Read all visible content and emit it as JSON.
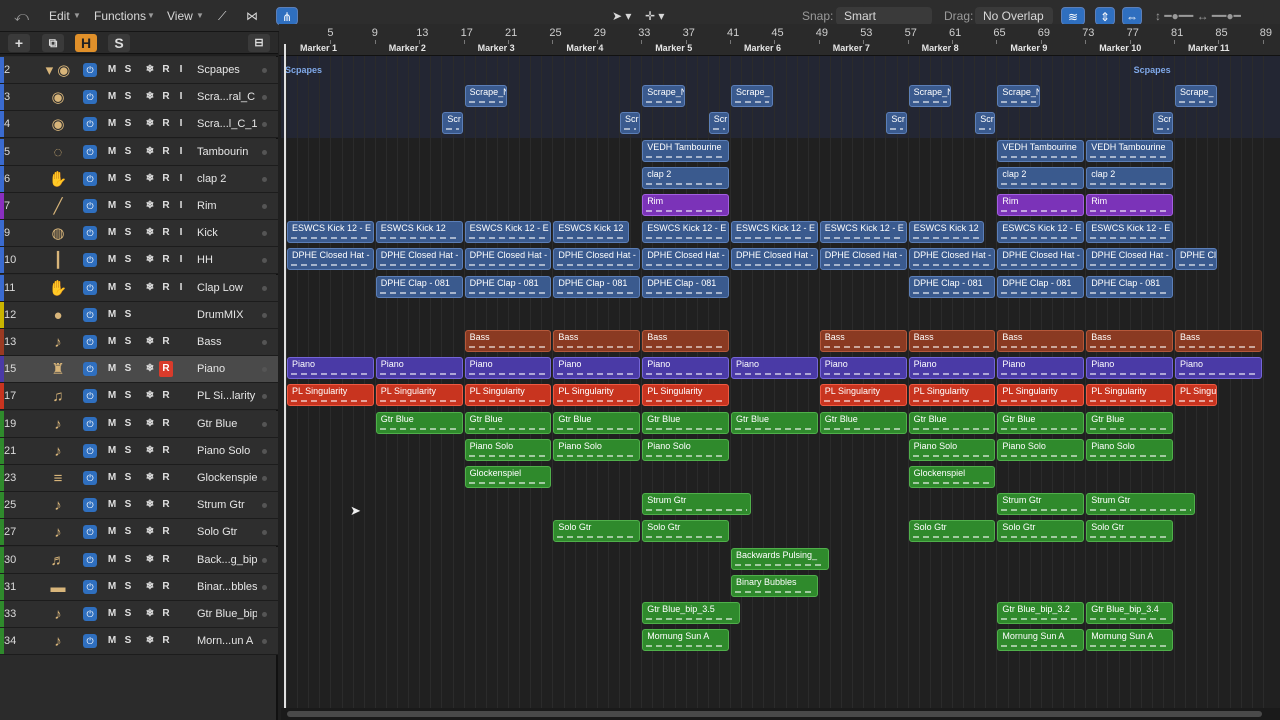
{
  "toolbar": {
    "back_icon": "back-arrow-icon",
    "menus": [
      "Edit",
      "Functions",
      "View"
    ],
    "snap_label": "Snap:",
    "snap_value": "Smart",
    "drag_label": "Drag:",
    "drag_value": "No Overlap"
  },
  "header_buttons": [
    "+",
    "H",
    "S"
  ],
  "ruler": {
    "bars": [
      "5",
      "9",
      "13",
      "17",
      "21",
      "25",
      "29",
      "33",
      "37",
      "41",
      "45",
      "49",
      "53",
      "57",
      "61",
      "65",
      "69",
      "73",
      "77",
      "81",
      "85",
      "89"
    ],
    "markers": [
      "Marker 1",
      "Marker 2",
      "Marker 3",
      "Marker 4",
      "Marker 5",
      "Marker 6",
      "Marker 7",
      "Marker 8",
      "Marker 9",
      "Marker 10",
      "Marker 11"
    ]
  },
  "tracks": [
    {
      "num": "2",
      "name": "Scpapes",
      "color": "#3a6bd0",
      "icon": "▾ ◉",
      "selected": false,
      "r": false
    },
    {
      "num": "3",
      "name": "Scra...ral_C",
      "color": "#3a6bd0",
      "icon": "◉",
      "selected": false,
      "r": false
    },
    {
      "num": "4",
      "name": "Scra...l_C_1",
      "color": "#3a6bd0",
      "icon": "◉",
      "selected": false,
      "r": false
    },
    {
      "num": "5",
      "name": "Tambourin",
      "color": "#3a6bd0",
      "icon": "◌",
      "selected": false,
      "r": false
    },
    {
      "num": "6",
      "name": "clap 2",
      "color": "#3a6bd0",
      "icon": "✋",
      "selected": false,
      "r": false
    },
    {
      "num": "7",
      "name": "Rim",
      "color": "#8a2fc0",
      "icon": "╱",
      "selected": false,
      "r": false
    },
    {
      "num": "9",
      "name": "Kick",
      "color": "#3a6bd0",
      "icon": "◍",
      "selected": false,
      "r": false
    },
    {
      "num": "10",
      "name": "HH",
      "color": "#3a6bd0",
      "icon": "┃",
      "selected": false,
      "r": false
    },
    {
      "num": "11",
      "name": "Clap Low",
      "color": "#3a6bd0",
      "icon": "✋",
      "selected": false,
      "r": false
    },
    {
      "num": "12",
      "name": "DrumMIX",
      "color": "#c9b400",
      "icon": "●",
      "selected": false,
      "r": false
    },
    {
      "num": "13",
      "name": "Bass",
      "color": "#9a3a22",
      "icon": "♪",
      "selected": false,
      "r": false
    },
    {
      "num": "15",
      "name": "Piano",
      "color": "#4a3aa6",
      "icon": "♜",
      "selected": true,
      "r": true
    },
    {
      "num": "17",
      "name": "PL Si...larity",
      "color": "#c8341f",
      "icon": "♫",
      "selected": false,
      "r": false
    },
    {
      "num": "19",
      "name": "Gtr Blue",
      "color": "#2f8a2c",
      "icon": "♪",
      "selected": false,
      "r": false
    },
    {
      "num": "21",
      "name": "Piano Solo",
      "color": "#2f8a2c",
      "icon": "♪",
      "selected": false,
      "r": false
    },
    {
      "num": "23",
      "name": "Glockenspiel",
      "color": "#2f8a2c",
      "icon": "≡",
      "selected": false,
      "r": false
    },
    {
      "num": "25",
      "name": "Strum Gtr",
      "color": "#2f8a2c",
      "icon": "♪",
      "selected": false,
      "r": false
    },
    {
      "num": "27",
      "name": "Solo Gtr",
      "color": "#2f8a2c",
      "icon": "♪",
      "selected": false,
      "r": false
    },
    {
      "num": "30",
      "name": "Back...g_bip",
      "color": "#2f8a2c",
      "icon": "♬",
      "selected": false,
      "r": false
    },
    {
      "num": "31",
      "name": "Binar...bbles",
      "color": "#2f8a2c",
      "icon": "▬",
      "selected": false,
      "r": false
    },
    {
      "num": "33",
      "name": "Gtr Blue_bip",
      "color": "#2f8a2c",
      "icon": "♪",
      "selected": false,
      "r": false
    },
    {
      "num": "34",
      "name": "Morn...un A",
      "color": "#2f8a2c",
      "icon": "♪",
      "selected": false,
      "r": false
    }
  ],
  "lane_labels": [
    "Scpapes",
    "Scpapes"
  ],
  "regions": [
    {
      "lane": 1,
      "bar": 17,
      "len": 4,
      "label": "Scrape_N",
      "color": "blue"
    },
    {
      "lane": 1,
      "bar": 33,
      "len": 4,
      "label": "Scrape_N",
      "color": "blue"
    },
    {
      "lane": 1,
      "bar": 41,
      "len": 4,
      "label": "Scrape_",
      "color": "blue"
    },
    {
      "lane": 1,
      "bar": 57,
      "len": 4,
      "label": "Scrape_N",
      "color": "blue"
    },
    {
      "lane": 1,
      "bar": 65,
      "len": 4,
      "label": "Scrape_N",
      "color": "blue"
    },
    {
      "lane": 1,
      "bar": 81,
      "len": 4,
      "label": "Scrape_",
      "color": "blue"
    },
    {
      "lane": 2,
      "bar": 15,
      "len": 2,
      "label": "Scr",
      "color": "blue"
    },
    {
      "lane": 2,
      "bar": 31,
      "len": 2,
      "label": "Scr",
      "color": "blue"
    },
    {
      "lane": 2,
      "bar": 39,
      "len": 2,
      "label": "Scr",
      "color": "blue"
    },
    {
      "lane": 2,
      "bar": 55,
      "len": 2,
      "label": "Scr",
      "color": "blue"
    },
    {
      "lane": 2,
      "bar": 63,
      "len": 2,
      "label": "Scr",
      "color": "blue"
    },
    {
      "lane": 2,
      "bar": 79,
      "len": 2,
      "label": "Scr",
      "color": "blue"
    },
    {
      "lane": 3,
      "bar": 33,
      "len": 8,
      "label": "VEDH Tambourine",
      "color": "blue"
    },
    {
      "lane": 3,
      "bar": 65,
      "len": 8,
      "label": "VEDH Tambourine",
      "color": "blue"
    },
    {
      "lane": 3,
      "bar": 73,
      "len": 8,
      "label": "VEDH Tambourine",
      "color": "blue"
    },
    {
      "lane": 4,
      "bar": 33,
      "len": 8,
      "label": "clap 2",
      "color": "blue"
    },
    {
      "lane": 4,
      "bar": 65,
      "len": 8,
      "label": "clap 2",
      "color": "blue"
    },
    {
      "lane": 4,
      "bar": 73,
      "len": 8,
      "label": "clap 2",
      "color": "blue"
    },
    {
      "lane": 5,
      "bar": 33,
      "len": 8,
      "label": "Rim",
      "color": "purple"
    },
    {
      "lane": 5,
      "bar": 65,
      "len": 8,
      "label": "Rim",
      "color": "purple"
    },
    {
      "lane": 5,
      "bar": 73,
      "len": 8,
      "label": "Rim",
      "color": "purple"
    },
    {
      "lane": 6,
      "bar": 1,
      "len": 8,
      "label": "ESWCS Kick 12 - E",
      "color": "blue"
    },
    {
      "lane": 6,
      "bar": 9,
      "len": 8,
      "label": "ESWCS Kick 12",
      "color": "blue"
    },
    {
      "lane": 6,
      "bar": 17,
      "len": 8,
      "label": "ESWCS Kick 12 - E",
      "color": "blue"
    },
    {
      "lane": 6,
      "bar": 25,
      "len": 7,
      "label": "ESWCS Kick 12",
      "color": "blue"
    },
    {
      "lane": 6,
      "bar": 33,
      "len": 8,
      "label": "ESWCS Kick 12 - E",
      "color": "blue"
    },
    {
      "lane": 6,
      "bar": 41,
      "len": 8,
      "label": "ESWCS Kick 12 - E",
      "color": "blue"
    },
    {
      "lane": 6,
      "bar": 49,
      "len": 8,
      "label": "ESWCS Kick 12 - E",
      "color": "blue"
    },
    {
      "lane": 6,
      "bar": 57,
      "len": 7,
      "label": "ESWCS Kick 12",
      "color": "blue"
    },
    {
      "lane": 6,
      "bar": 65,
      "len": 8,
      "label": "ESWCS Kick 12 - E",
      "color": "blue"
    },
    {
      "lane": 6,
      "bar": 73,
      "len": 8,
      "label": "ESWCS Kick 12 - E",
      "color": "blue"
    },
    {
      "lane": 7,
      "bar": 1,
      "len": 8,
      "label": "DPHE Closed Hat -",
      "color": "blue"
    },
    {
      "lane": 7,
      "bar": 9,
      "len": 8,
      "label": "DPHE Closed Hat -",
      "color": "blue"
    },
    {
      "lane": 7,
      "bar": 17,
      "len": 8,
      "label": "DPHE Closed Hat -",
      "color": "blue"
    },
    {
      "lane": 7,
      "bar": 25,
      "len": 8,
      "label": "DPHE Closed Hat -",
      "color": "blue"
    },
    {
      "lane": 7,
      "bar": 33,
      "len": 8,
      "label": "DPHE Closed Hat -",
      "color": "blue"
    },
    {
      "lane": 7,
      "bar": 41,
      "len": 8,
      "label": "DPHE Closed Hat -",
      "color": "blue"
    },
    {
      "lane": 7,
      "bar": 49,
      "len": 8,
      "label": "DPHE Closed Hat -",
      "color": "blue"
    },
    {
      "lane": 7,
      "bar": 57,
      "len": 8,
      "label": "DPHE Closed Hat -",
      "color": "blue"
    },
    {
      "lane": 7,
      "bar": 65,
      "len": 8,
      "label": "DPHE Closed Hat -",
      "color": "blue"
    },
    {
      "lane": 7,
      "bar": 73,
      "len": 8,
      "label": "DPHE Closed Hat -",
      "color": "blue"
    },
    {
      "lane": 7,
      "bar": 81,
      "len": 4,
      "label": "DPHE Cl",
      "color": "blue"
    },
    {
      "lane": 8,
      "bar": 9,
      "len": 8,
      "label": "DPHE Clap - 081",
      "color": "blue"
    },
    {
      "lane": 8,
      "bar": 17,
      "len": 8,
      "label": "DPHE Clap - 081",
      "color": "blue"
    },
    {
      "lane": 8,
      "bar": 25,
      "len": 8,
      "label": "DPHE Clap - 081",
      "color": "blue"
    },
    {
      "lane": 8,
      "bar": 33,
      "len": 8,
      "label": "DPHE Clap - 081",
      "color": "blue"
    },
    {
      "lane": 8,
      "bar": 57,
      "len": 8,
      "label": "DPHE Clap - 081",
      "color": "blue"
    },
    {
      "lane": 8,
      "bar": 65,
      "len": 8,
      "label": "DPHE Clap - 081",
      "color": "blue"
    },
    {
      "lane": 8,
      "bar": 73,
      "len": 8,
      "label": "DPHE Clap - 081",
      "color": "blue"
    },
    {
      "lane": 10,
      "bar": 17,
      "len": 8,
      "label": "Bass",
      "color": "brown"
    },
    {
      "lane": 10,
      "bar": 25,
      "len": 8,
      "label": "Bass",
      "color": "brown"
    },
    {
      "lane": 10,
      "bar": 33,
      "len": 8,
      "label": "Bass",
      "color": "brown"
    },
    {
      "lane": 10,
      "bar": 49,
      "len": 8,
      "label": "Bass",
      "color": "brown"
    },
    {
      "lane": 10,
      "bar": 57,
      "len": 8,
      "label": "Bass",
      "color": "brown"
    },
    {
      "lane": 10,
      "bar": 65,
      "len": 8,
      "label": "Bass",
      "color": "brown"
    },
    {
      "lane": 10,
      "bar": 73,
      "len": 8,
      "label": "Bass",
      "color": "brown"
    },
    {
      "lane": 10,
      "bar": 81,
      "len": 8,
      "label": "Bass",
      "color": "brown"
    },
    {
      "lane": 11,
      "bar": 1,
      "len": 8,
      "label": "Piano",
      "color": "indigo"
    },
    {
      "lane": 11,
      "bar": 9,
      "len": 8,
      "label": "Piano",
      "color": "indigo"
    },
    {
      "lane": 11,
      "bar": 17,
      "len": 8,
      "label": "Piano",
      "color": "indigo"
    },
    {
      "lane": 11,
      "bar": 25,
      "len": 8,
      "label": "Piano",
      "color": "indigo"
    },
    {
      "lane": 11,
      "bar": 33,
      "len": 8,
      "label": "Piano",
      "color": "indigo"
    },
    {
      "lane": 11,
      "bar": 41,
      "len": 8,
      "label": "Piano",
      "color": "indigo"
    },
    {
      "lane": 11,
      "bar": 49,
      "len": 8,
      "label": "Piano",
      "color": "indigo"
    },
    {
      "lane": 11,
      "bar": 57,
      "len": 8,
      "label": "Piano",
      "color": "indigo"
    },
    {
      "lane": 11,
      "bar": 65,
      "len": 8,
      "label": "Piano",
      "color": "indigo"
    },
    {
      "lane": 11,
      "bar": 73,
      "len": 8,
      "label": "Piano",
      "color": "indigo"
    },
    {
      "lane": 11,
      "bar": 81,
      "len": 8,
      "label": "Piano",
      "color": "indigo"
    },
    {
      "lane": 12,
      "bar": 1,
      "len": 8,
      "label": "PL Singularity",
      "color": "red"
    },
    {
      "lane": 12,
      "bar": 9,
      "len": 8,
      "label": "PL Singularity",
      "color": "red"
    },
    {
      "lane": 12,
      "bar": 17,
      "len": 8,
      "label": "PL Singularity",
      "color": "red"
    },
    {
      "lane": 12,
      "bar": 25,
      "len": 8,
      "label": "PL Singularity",
      "color": "red"
    },
    {
      "lane": 12,
      "bar": 33,
      "len": 8,
      "label": "PL Singularity",
      "color": "red"
    },
    {
      "lane": 12,
      "bar": 49,
      "len": 8,
      "label": "PL Singularity",
      "color": "red"
    },
    {
      "lane": 12,
      "bar": 57,
      "len": 8,
      "label": "PL Singularity",
      "color": "red"
    },
    {
      "lane": 12,
      "bar": 65,
      "len": 8,
      "label": "PL Singularity",
      "color": "red"
    },
    {
      "lane": 12,
      "bar": 73,
      "len": 8,
      "label": "PL Singularity",
      "color": "red"
    },
    {
      "lane": 12,
      "bar": 81,
      "len": 4,
      "label": "PL Singul",
      "color": "red"
    },
    {
      "lane": 13,
      "bar": 9,
      "len": 8,
      "label": "Gtr Blue",
      "color": "green"
    },
    {
      "lane": 13,
      "bar": 17,
      "len": 8,
      "label": "Gtr Blue",
      "color": "green"
    },
    {
      "lane": 13,
      "bar": 25,
      "len": 8,
      "label": "Gtr Blue",
      "color": "green"
    },
    {
      "lane": 13,
      "bar": 33,
      "len": 8,
      "label": "Gtr Blue",
      "color": "green"
    },
    {
      "lane": 13,
      "bar": 41,
      "len": 8,
      "label": "Gtr Blue",
      "color": "green"
    },
    {
      "lane": 13,
      "bar": 49,
      "len": 8,
      "label": "Gtr Blue",
      "color": "green"
    },
    {
      "lane": 13,
      "bar": 57,
      "len": 8,
      "label": "Gtr Blue",
      "color": "green"
    },
    {
      "lane": 13,
      "bar": 65,
      "len": 8,
      "label": "Gtr Blue",
      "color": "green"
    },
    {
      "lane": 13,
      "bar": 73,
      "len": 8,
      "label": "Gtr Blue",
      "color": "green"
    },
    {
      "lane": 14,
      "bar": 17,
      "len": 8,
      "label": "Piano Solo",
      "color": "green"
    },
    {
      "lane": 14,
      "bar": 25,
      "len": 8,
      "label": "Piano Solo",
      "color": "green"
    },
    {
      "lane": 14,
      "bar": 33,
      "len": 8,
      "label": "Piano Solo",
      "color": "green"
    },
    {
      "lane": 14,
      "bar": 57,
      "len": 8,
      "label": "Piano Solo",
      "color": "green"
    },
    {
      "lane": 14,
      "bar": 65,
      "len": 8,
      "label": "Piano Solo",
      "color": "green"
    },
    {
      "lane": 14,
      "bar": 73,
      "len": 8,
      "label": "Piano Solo",
      "color": "green"
    },
    {
      "lane": 15,
      "bar": 17,
      "len": 8,
      "label": "Glockenspiel",
      "color": "green"
    },
    {
      "lane": 15,
      "bar": 57,
      "len": 8,
      "label": "Glockenspiel",
      "color": "green"
    },
    {
      "lane": 16,
      "bar": 33,
      "len": 10,
      "label": "Strum Gtr",
      "color": "green"
    },
    {
      "lane": 16,
      "bar": 65,
      "len": 8,
      "label": "Strum Gtr",
      "color": "green"
    },
    {
      "lane": 16,
      "bar": 73,
      "len": 10,
      "label": "Strum Gtr",
      "color": "green"
    },
    {
      "lane": 17,
      "bar": 25,
      "len": 8,
      "label": "Solo Gtr",
      "color": "green"
    },
    {
      "lane": 17,
      "bar": 33,
      "len": 8,
      "label": "Solo Gtr",
      "color": "green"
    },
    {
      "lane": 17,
      "bar": 57,
      "len": 8,
      "label": "Solo Gtr",
      "color": "green"
    },
    {
      "lane": 17,
      "bar": 65,
      "len": 8,
      "label": "Solo Gtr",
      "color": "green"
    },
    {
      "lane": 17,
      "bar": 73,
      "len": 8,
      "label": "Solo Gtr",
      "color": "green"
    },
    {
      "lane": 18,
      "bar": 41,
      "len": 9,
      "label": "Backwards Pulsing_",
      "color": "green"
    },
    {
      "lane": 19,
      "bar": 41,
      "len": 8,
      "label": "Binary Bubbles",
      "color": "green"
    },
    {
      "lane": 20,
      "bar": 33,
      "len": 9,
      "label": "Gtr Blue_bip_3.5",
      "color": "green"
    },
    {
      "lane": 20,
      "bar": 65,
      "len": 8,
      "label": "Gtr Blue_bip_3.2",
      "color": "green"
    },
    {
      "lane": 20,
      "bar": 73,
      "len": 8,
      "label": "Gtr Blue_bip_3.4",
      "color": "green"
    },
    {
      "lane": 21,
      "bar": 33,
      "len": 8,
      "label": "Mornung Sun A",
      "color": "green"
    },
    {
      "lane": 21,
      "bar": 65,
      "len": 8,
      "label": "Mornung Sun A",
      "color": "green"
    },
    {
      "lane": 21,
      "bar": 73,
      "len": 8,
      "label": "Mornung Sun A",
      "color": "green"
    }
  ]
}
